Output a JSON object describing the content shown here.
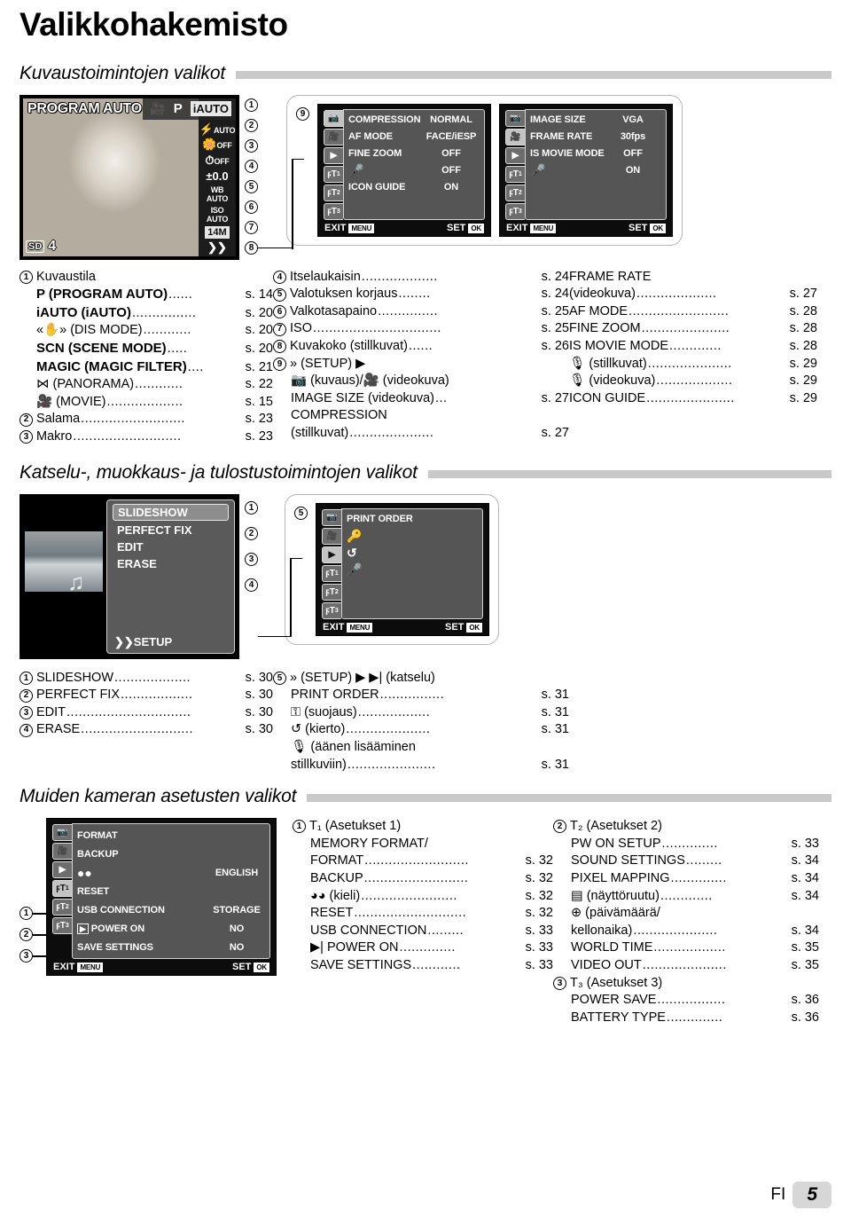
{
  "page": {
    "title": "Valikkohakemisto",
    "language_code": "FI",
    "page_number": "5"
  },
  "sections": [
    {
      "id": "shooting",
      "heading": "Kuvaustoimintojen valikot"
    },
    {
      "id": "playback",
      "heading": "Katselu-, muokkaus- ja tulostustoimintojen valikot"
    },
    {
      "id": "setup",
      "heading": "Muiden kameran asetusten valikot"
    }
  ],
  "liveview": {
    "mode_label": "PROGRAM AUTO",
    "modes": [
      "movie-icon",
      "P",
      "iAUTO"
    ],
    "selected_mode": "iAUTO",
    "side_items": [
      {
        "name": "flash",
        "line1": "flash-icon",
        "line2": "AUTO"
      },
      {
        "name": "macro",
        "line1": "macro-icon",
        "line2": "OFF"
      },
      {
        "name": "selftimer",
        "line1": "timer-icon",
        "line2": "OFF"
      },
      {
        "name": "exposure",
        "line1": "±0.0",
        "line2": ""
      },
      {
        "name": "white-balance",
        "line1": "WB",
        "line2": "AUTO"
      },
      {
        "name": "iso",
        "line1": "ISO",
        "line2": "AUTO"
      },
      {
        "name": "image-size",
        "line1": "14M",
        "line2": ""
      },
      {
        "name": "setup",
        "line1": "setup-icon",
        "line2": ""
      }
    ],
    "bottom_left": {
      "card": "SD",
      "count": "4"
    },
    "callouts": [
      "1",
      "2",
      "3",
      "4",
      "5",
      "6",
      "7",
      "8"
    ]
  },
  "menu_shooting_still": {
    "callout": "9",
    "tabs": [
      "camera-icon",
      "movie-icon",
      "playback-icon",
      "T1",
      "T2",
      "T3"
    ],
    "selected_tab": 0,
    "rows": [
      {
        "label": "COMPRESSION",
        "value": "NORMAL"
      },
      {
        "label": "AF MODE",
        "value": "FACE/iESP"
      },
      {
        "label": "FINE ZOOM",
        "value": "OFF"
      },
      {
        "label": "mic-icon",
        "value": "OFF"
      },
      {
        "label": "ICON GUIDE",
        "value": "ON"
      }
    ],
    "exit_label": "EXIT",
    "exit_key": "MENU",
    "set_label": "SET",
    "set_key": "OK"
  },
  "menu_shooting_movie": {
    "tabs": [
      "camera-icon",
      "movie-icon",
      "playback-icon",
      "T1",
      "T2",
      "T3"
    ],
    "selected_tab": 1,
    "rows": [
      {
        "label": "IMAGE SIZE",
        "value": "VGA"
      },
      {
        "label": "FRAME RATE",
        "value": "30fps"
      },
      {
        "label": "IS MOVIE MODE",
        "value": "OFF"
      },
      {
        "label": "mic-icon",
        "value": "ON"
      }
    ],
    "exit_label": "EXIT",
    "exit_key": "MENU",
    "set_label": "SET",
    "set_key": "OK"
  },
  "shooting_index": {
    "col1": [
      {
        "num": "1",
        "text": "Kuvaustila",
        "dots": "",
        "page": ""
      },
      {
        "num": "",
        "text": "P (PROGRAM AUTO)",
        "dots": "......",
        "page": "s. 14"
      },
      {
        "num": "",
        "text": "iAUTO (iAUTO)",
        "dots": "................",
        "page": "s. 20"
      },
      {
        "num": "",
        "text": "«✋» (DIS MODE)",
        "dots": "............",
        "page": "s. 20"
      },
      {
        "num": "",
        "text": "SCN (SCENE MODE)",
        "dots": ".....",
        "page": "s. 20"
      },
      {
        "num": "",
        "text": "MAGIC (MAGIC FILTER)",
        "dots": "....",
        "page": "s. 21"
      },
      {
        "num": "",
        "text": "⋈ (PANORAMA)",
        "dots": "............",
        "page": "s. 22"
      },
      {
        "num": "",
        "text": "🎥 (MOVIE)",
        "dots": "...................",
        "page": "s. 15"
      },
      {
        "num": "2",
        "text": "Salama",
        "dots": "..........................",
        "page": "s. 23"
      },
      {
        "num": "3",
        "text": "Makro",
        "dots": "...........................",
        "page": "s. 23"
      }
    ],
    "col2": [
      {
        "num": "4",
        "text": "Itselaukaisin",
        "dots": "...................",
        "page": "s. 24"
      },
      {
        "num": "5",
        "text": "Valotuksen korjaus",
        "dots": "........",
        "page": "s. 24"
      },
      {
        "num": "6",
        "text": "Valkotasapaino",
        "dots": "...............",
        "page": "s. 25"
      },
      {
        "num": "7",
        "text": "ISO",
        "dots": "................................",
        "page": "s. 25"
      },
      {
        "num": "8",
        "text": "Kuvakoko (stillkuvat)",
        "dots": "......",
        "page": "s. 26"
      },
      {
        "num": "9",
        "text": "» (SETUP) ▶",
        "dots": "",
        "page": ""
      },
      {
        "num": "",
        "text": "📷 (kuvaus)/🎥 (videokuva)",
        "dots": "",
        "page": "",
        "indent": true
      },
      {
        "num": "",
        "text": "IMAGE SIZE (videokuva)",
        "dots": "...",
        "page": "s. 27",
        "indent": true
      },
      {
        "num": "",
        "text": "COMPRESSION",
        "dots": "",
        "page": "",
        "indent": true
      },
      {
        "num": "",
        "text": "(stillkuvat)",
        "dots": ".....................",
        "page": "s. 27",
        "indent": true
      }
    ],
    "col3": [
      {
        "num": "",
        "text": "FRAME RATE",
        "dots": "",
        "page": ""
      },
      {
        "num": "",
        "text": "(videokuva)",
        "dots": "....................",
        "page": "s. 27"
      },
      {
        "num": "",
        "text": "AF MODE",
        "dots": ".........................",
        "page": "s. 28"
      },
      {
        "num": "",
        "text": "FINE ZOOM",
        "dots": "......................",
        "page": "s. 28"
      },
      {
        "num": "",
        "text": "IS MOVIE MODE",
        "dots": ".............",
        "page": "s. 28"
      },
      {
        "num": "",
        "text": "🎙 (stillkuvat)",
        "dots": ".....................",
        "page": "s. 29"
      },
      {
        "num": "",
        "text": "🎙 (videokuva)",
        "dots": "...................",
        "page": "s. 29"
      },
      {
        "num": "",
        "text": "ICON GUIDE",
        "dots": "......................",
        "page": "s. 29"
      }
    ]
  },
  "menu_playback_main": {
    "items": [
      {
        "label": "SLIDESHOW",
        "callout": "1",
        "selected": true
      },
      {
        "label": "PERFECT FIX",
        "callout": "2",
        "selected": false
      },
      {
        "label": "EDIT",
        "callout": "3",
        "selected": false
      },
      {
        "label": "ERASE",
        "callout": "4",
        "selected": false
      }
    ],
    "setup_label": "SETUP"
  },
  "menu_playback_setup": {
    "callout": "5",
    "tabs": [
      "camera-icon",
      "movie-icon",
      "playback-icon",
      "T1",
      "T2",
      "T3"
    ],
    "selected_tab": 2,
    "rows": [
      {
        "label": "PRINT ORDER",
        "value": ""
      },
      {
        "label": "key-icon",
        "value": ""
      },
      {
        "label": "rotate-icon",
        "value": ""
      },
      {
        "label": "mic-icon",
        "value": ""
      }
    ],
    "exit_label": "EXIT",
    "exit_key": "MENU",
    "set_label": "SET",
    "set_key": "OK"
  },
  "playback_index": {
    "col1": [
      {
        "num": "1",
        "text": "SLIDESHOW",
        "dots": "...................",
        "page": "s. 30"
      },
      {
        "num": "2",
        "text": "PERFECT FIX",
        "dots": "..................",
        "page": "s. 30"
      },
      {
        "num": "3",
        "text": "EDIT",
        "dots": "...............................",
        "page": "s. 30"
      },
      {
        "num": "4",
        "text": "ERASE",
        "dots": "............................",
        "page": "s. 30"
      }
    ],
    "col2": [
      {
        "num": "5",
        "text": "» (SETUP) ▶ ▶| (katselu)",
        "dots": "",
        "page": ""
      },
      {
        "num": "",
        "text": "PRINT ORDER",
        "dots": "................",
        "page": "s. 31",
        "indent": true
      },
      {
        "num": "",
        "text": "⚿ (suojaus)",
        "dots": "..................",
        "page": "s. 31",
        "indent": true
      },
      {
        "num": "",
        "text": "↺ (kierto)",
        "dots": ".....................",
        "page": "s. 31",
        "indent": true
      },
      {
        "num": "",
        "text": "🎙 (äänen lisääminen",
        "dots": "",
        "page": "",
        "indent": true
      },
      {
        "num": "",
        "text": "stillkuviin)",
        "dots": "......................",
        "page": "s. 31",
        "indent": true
      }
    ]
  },
  "menu_setup": {
    "tabs": [
      "camera-icon",
      "movie-icon",
      "playback-icon",
      "T1",
      "T2",
      "T3"
    ],
    "selected_tab": 3,
    "tab_callouts": [
      "1",
      "2",
      "3"
    ],
    "rows": [
      {
        "label": "FORMAT",
        "value": ""
      },
      {
        "label": "BACKUP",
        "value": ""
      },
      {
        "label": "language-icon",
        "value": "ENGLISH"
      },
      {
        "label": "RESET",
        "value": ""
      },
      {
        "label": "USB CONNECTION",
        "value": "STORAGE"
      },
      {
        "label": "playback-icon POWER ON",
        "value": "NO"
      },
      {
        "label": "SAVE SETTINGS",
        "value": "NO"
      }
    ],
    "exit_label": "EXIT",
    "exit_key": "MENU",
    "set_label": "SET",
    "set_key": "OK"
  },
  "setup_index": {
    "col1": [
      {
        "num": "1",
        "text": "T₁ (Asetukset 1)",
        "dots": "",
        "page": ""
      },
      {
        "num": "",
        "text": "MEMORY FORMAT/",
        "dots": "",
        "page": "",
        "indent": true
      },
      {
        "num": "",
        "text": "FORMAT",
        "dots": "..........................",
        "page": "s. 32",
        "indent": true
      },
      {
        "num": "",
        "text": "BACKUP",
        "dots": "..........................",
        "page": "s. 32",
        "indent": true
      },
      {
        "num": "",
        "text": "◕◕ (kieli)",
        "dots": "........................",
        "page": "s. 32",
        "indent": true
      },
      {
        "num": "",
        "text": "RESET",
        "dots": "............................",
        "page": "s. 32",
        "indent": true
      },
      {
        "num": "",
        "text": "USB CONNECTION",
        "dots": ".........",
        "page": "s. 33",
        "indent": true
      },
      {
        "num": "",
        "text": "▶| POWER ON",
        "dots": "..............",
        "page": "s. 33",
        "indent": true
      },
      {
        "num": "",
        "text": "SAVE SETTINGS",
        "dots": "............",
        "page": "s. 33",
        "indent": true
      }
    ],
    "col2": [
      {
        "num": "2",
        "text": "T₂ (Asetukset 2)",
        "dots": "",
        "page": ""
      },
      {
        "num": "",
        "text": "PW ON SETUP",
        "dots": "..............",
        "page": "s. 33",
        "indent": true
      },
      {
        "num": "",
        "text": "SOUND SETTINGS",
        "dots": ".........",
        "page": "s. 34",
        "indent": true
      },
      {
        "num": "",
        "text": "PIXEL MAPPING",
        "dots": "..............",
        "page": "s. 34",
        "indent": true
      },
      {
        "num": "",
        "text": "▤ (näyttöruutu)",
        "dots": ".............",
        "page": "s. 34",
        "indent": true
      },
      {
        "num": "",
        "text": "⊕ (päivämäärä/",
        "dots": "",
        "page": "",
        "indent": true
      },
      {
        "num": "",
        "text": "kellonaika)",
        "dots": ".....................",
        "page": "s. 34",
        "indent": true
      },
      {
        "num": "",
        "text": "WORLD TIME",
        "dots": "..................",
        "page": "s. 35",
        "indent": true
      },
      {
        "num": "",
        "text": "VIDEO OUT",
        "dots": ".....................",
        "page": "s. 35",
        "indent": true
      },
      {
        "num": "3",
        "text": "T₃ (Asetukset 3)",
        "dots": "",
        "page": ""
      },
      {
        "num": "",
        "text": "POWER SAVE",
        "dots": ".................",
        "page": "s. 36",
        "indent": true
      },
      {
        "num": "",
        "text": "BATTERY TYPE",
        "dots": "..............",
        "page": "s. 36",
        "indent": true
      }
    ]
  }
}
